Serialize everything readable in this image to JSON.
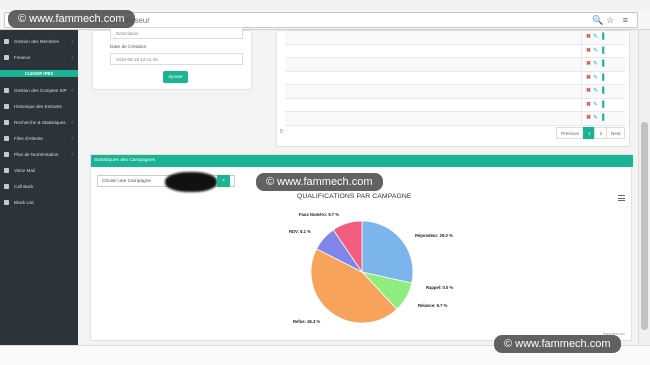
{
  "browser": {
    "url_text": "ige=fournisseur",
    "url_icons": "🔍☆ ≡"
  },
  "watermark": "© www.fammech.com",
  "sidebar": {
    "items": [
      {
        "label": "Gestion des Membres",
        "chev": "‹"
      },
      {
        "label": "Finance",
        "chev": "‹"
      },
      {
        "label": "Gestion des Comptes SIP",
        "chev": "‹"
      },
      {
        "label": "Historique des Entrants",
        "chev": ""
      },
      {
        "label": "Recherche & Statistiques",
        "chev": "‹"
      },
      {
        "label": "Files d'Attente",
        "chev": "‹"
      },
      {
        "label": "Plan de Numérotation",
        "chev": "‹"
      },
      {
        "label": "Voice Mail",
        "chev": ""
      },
      {
        "label": "Call Back",
        "chev": ""
      },
      {
        "label": "Black List",
        "chev": ""
      }
    ],
    "separator": "CLEGER IPBX"
  },
  "form": {
    "description_placeholder": "Description",
    "date_label": "Date de Création",
    "date_value": "2016-08-19 12:41:45",
    "add_button": "Ajouter"
  },
  "table": {
    "row_count": 7,
    "action_delete": "✖",
    "action_edit": "✎",
    "action_stats": "▐",
    "pager": [
      "Previous",
      "1",
      "2",
      "Next"
    ],
    "pager_active": "1",
    "row_marker": "B"
  },
  "stats": {
    "header": "Statistiques des Campagnes",
    "select_placeholder": "Choisir une Campagne",
    "clear_icon": "×",
    "credits": "Highcharts.com"
  },
  "chart_data": {
    "type": "pie",
    "title": "QUALIFICATIONS PAR CAMPAGNE",
    "slices": [
      {
        "name": "Répondeur",
        "label": "Répondeur: 29.0 %",
        "value": 29.0,
        "color": "#7cb5ec"
      },
      {
        "name": "Rappel",
        "label": "Rappel: 0.0 %",
        "value": 0.0,
        "color": "#434348"
      },
      {
        "name": "Relance",
        "label": "Relance: 9.7 %",
        "value": 9.7,
        "color": "#90ed7d"
      },
      {
        "name": "Refus",
        "label": "Refus: 45.3 %",
        "value": 45.3,
        "color": "#f7a35c"
      },
      {
        "name": "RDV",
        "label": "RDV: 8.1 %",
        "value": 8.1,
        "color": "#8085e9"
      },
      {
        "name": "Faux Numéro",
        "label": "Faux Numéro: 9.7 %",
        "value": 9.7,
        "color": "#f15c80"
      }
    ]
  }
}
